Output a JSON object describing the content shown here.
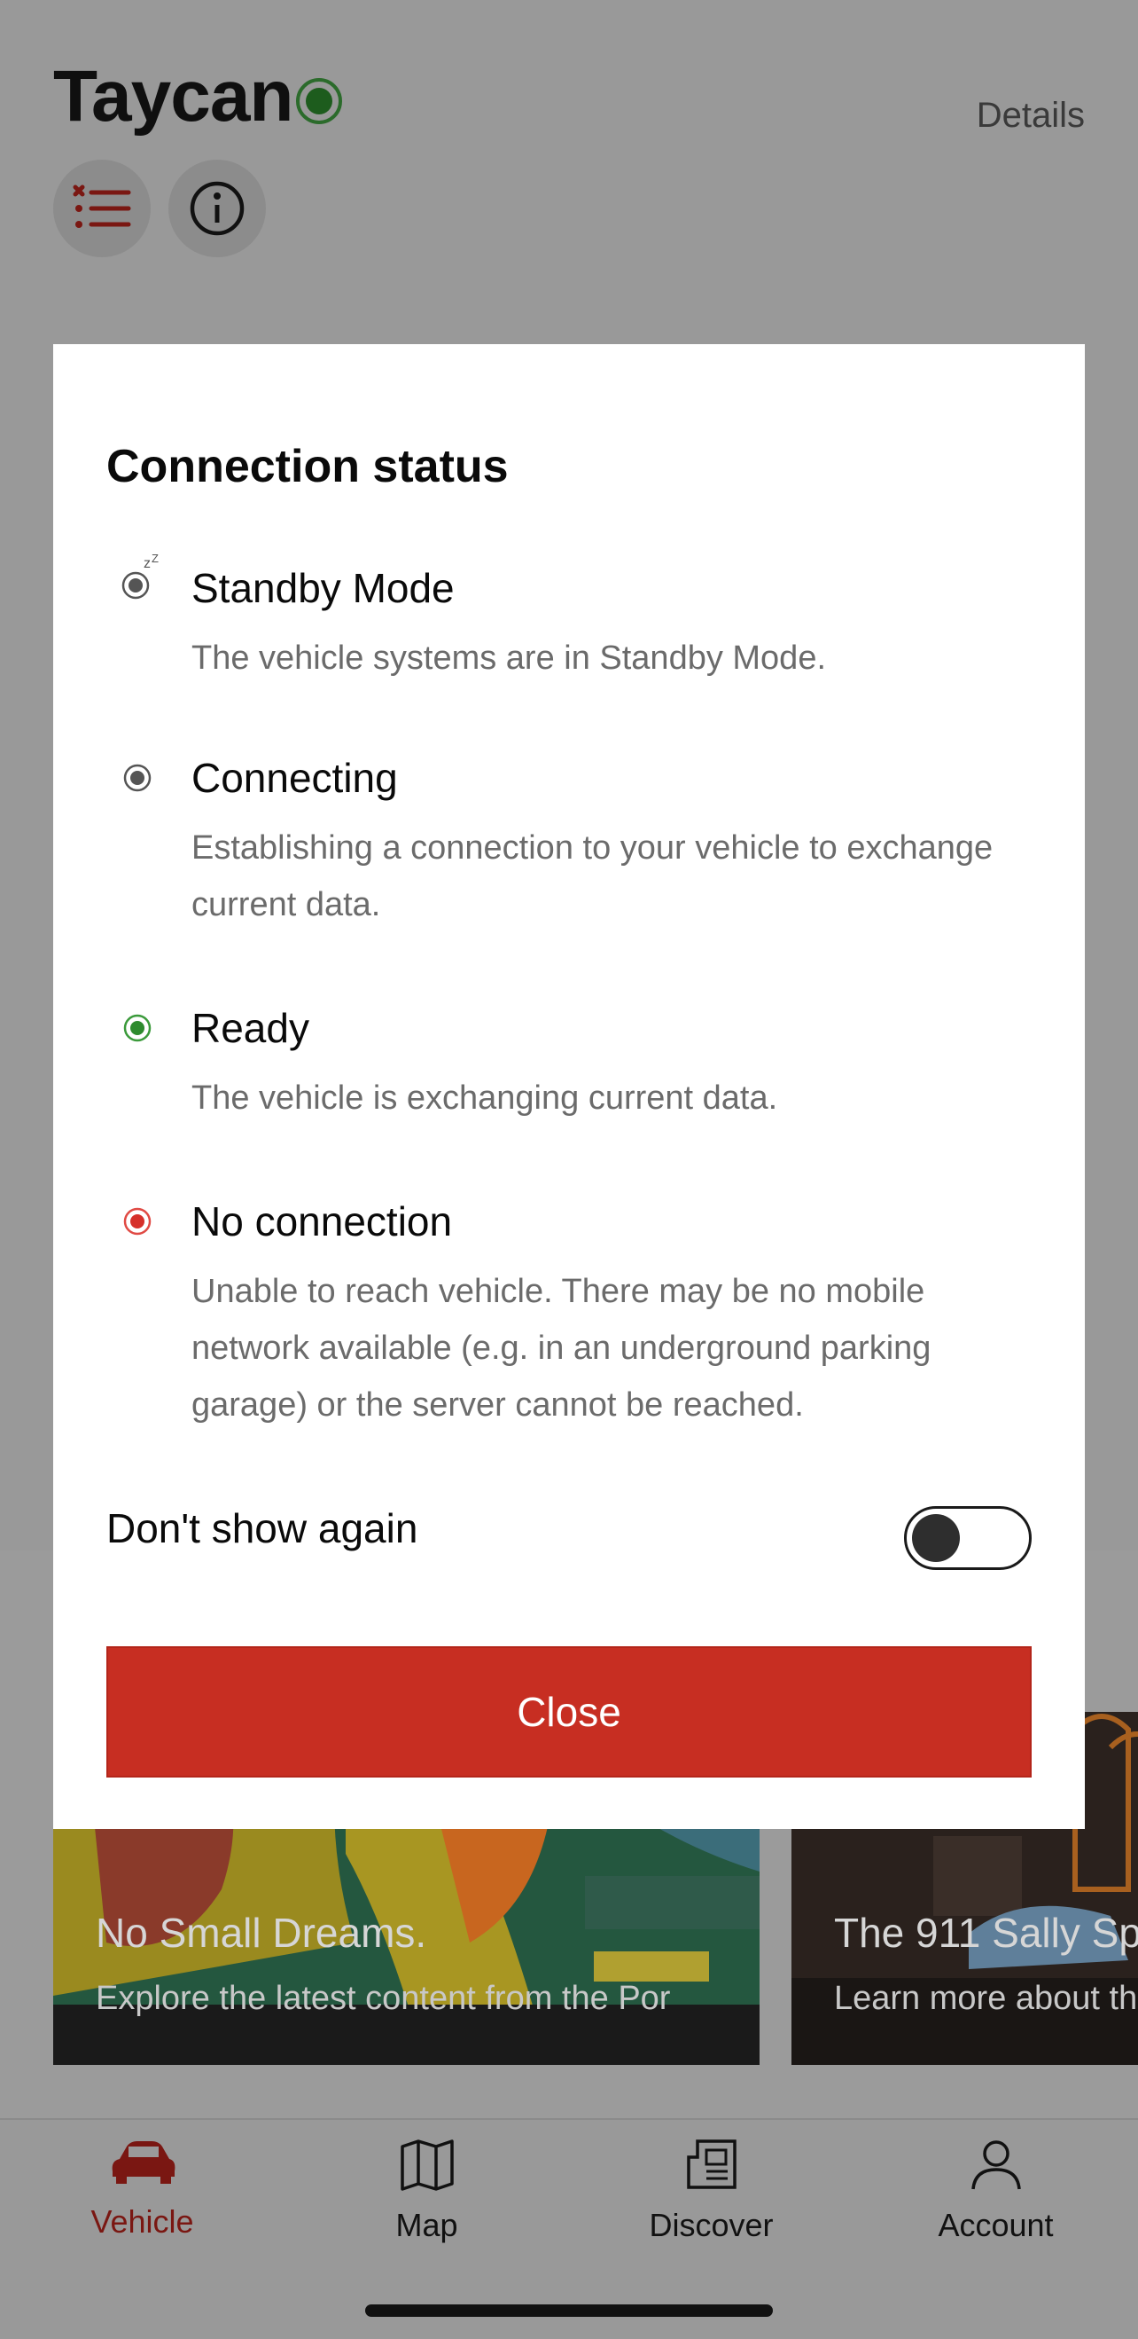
{
  "header": {
    "vehicle_name": "Taycan",
    "details_label": "Details"
  },
  "cards": [
    {
      "title": "No Small Dreams.",
      "subtitle": "Explore the latest content from the Por"
    },
    {
      "title": "The 911 Sally Spe",
      "subtitle": "Learn more about th"
    }
  ],
  "modal": {
    "title": "Connection status",
    "statuses": [
      {
        "name": "Standby Mode",
        "description": "The vehicle systems are in Standby Mode.",
        "icon": "standby-icon",
        "color": "#555555"
      },
      {
        "name": "Connecting",
        "description": "Establishing a connection to your vehicle to exchange current data.",
        "icon": "connecting-icon",
        "color": "#555555"
      },
      {
        "name": "Ready",
        "description": "The vehicle is exchanging current data.",
        "icon": "ready-icon",
        "color": "#2e8b2e"
      },
      {
        "name": "No connection",
        "description": "Unable to reach vehicle. There may be no mobile network available (e.g. in an underground parking garage) or the server cannot be reached.",
        "icon": "no-connection-icon",
        "color": "#d6302a"
      }
    ],
    "dont_show_label": "Don't show again",
    "dont_show_enabled": false,
    "close_label": "Close"
  },
  "tabbar": {
    "items": [
      {
        "label": "Vehicle",
        "icon": "car-icon",
        "active": true
      },
      {
        "label": "Map",
        "icon": "map-icon",
        "active": false
      },
      {
        "label": "Discover",
        "icon": "news-icon",
        "active": false
      },
      {
        "label": "Account",
        "icon": "person-icon",
        "active": false
      }
    ]
  },
  "colors": {
    "accent": "#c72e22",
    "active_tab": "#7a1712"
  }
}
